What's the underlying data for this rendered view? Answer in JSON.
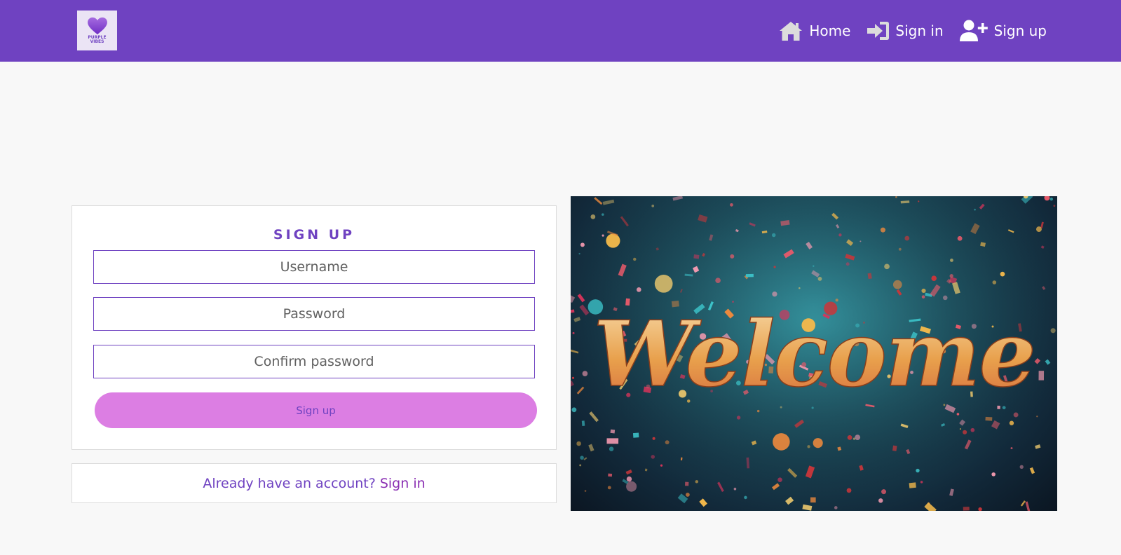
{
  "nav": {
    "logo": {
      "text_line1": "PURPLE",
      "text_line2": "VIBES",
      "icon": "heart-icon"
    },
    "links": [
      {
        "label": "Home",
        "icon": "home-icon"
      },
      {
        "label": "Sign in",
        "icon": "sign-in-icon"
      },
      {
        "label": "Sign up",
        "icon": "user-plus-icon"
      }
    ]
  },
  "form": {
    "title": "SIGN UP",
    "username_placeholder": "Username",
    "password_placeholder": "Password",
    "confirm_placeholder": "Confirm password",
    "submit_label": "Sign up"
  },
  "signin_prompt": {
    "question": "Already have an account?",
    "link": "Sign in"
  },
  "hero": {
    "text": "Welcome"
  },
  "colors": {
    "brand": "#6f42c1",
    "button": "#dc7ee3",
    "background": "#f8f8f8"
  }
}
